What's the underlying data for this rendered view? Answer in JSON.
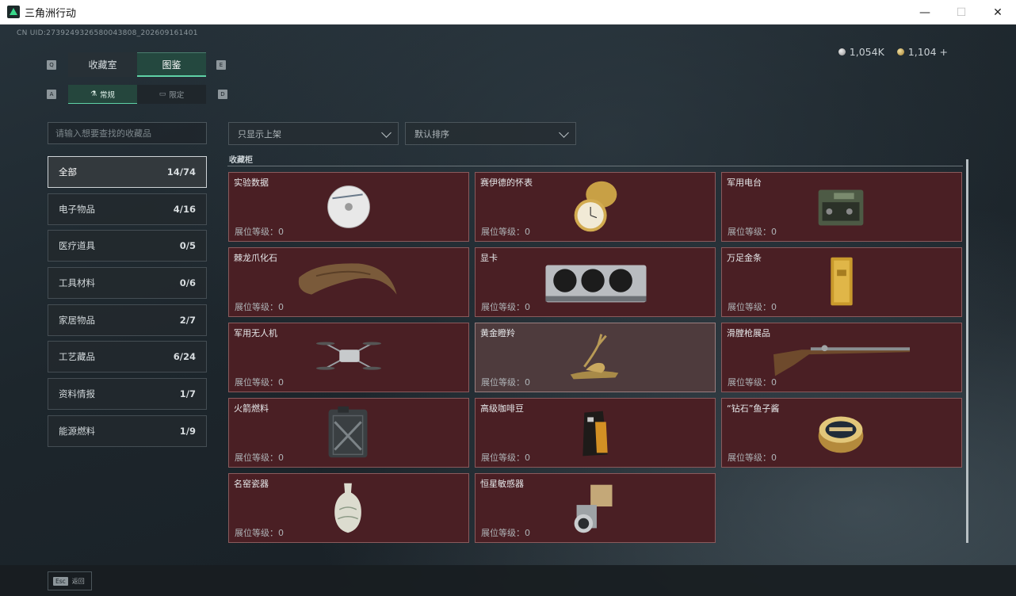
{
  "window": {
    "title": "三角洲行动",
    "minimize": "—",
    "maximize": "☐",
    "close": "✕"
  },
  "header": {
    "uid": "CN UID:2739249326580043808_202609161401",
    "currency": [
      {
        "icon": "silver-coin-icon",
        "value": "1,054K"
      },
      {
        "icon": "gold-coin-icon",
        "value": "1,104 +"
      }
    ]
  },
  "tabs": {
    "key_left": "Q",
    "key_right": "E",
    "main": [
      {
        "label": "收藏室",
        "active": false
      },
      {
        "label": "图鉴",
        "active": true
      }
    ],
    "sub_key_left": "A",
    "sub_key_right": "D",
    "sub": [
      {
        "label": "常规",
        "icon": "flask-icon",
        "active": true
      },
      {
        "label": "限定",
        "icon": "frame-icon",
        "active": false
      }
    ]
  },
  "search": {
    "placeholder": "请输入想要查找的收藏品",
    "value": ""
  },
  "filters": [
    {
      "label": "只显示上架"
    },
    {
      "label": "默认排序"
    }
  ],
  "categories": [
    {
      "label": "全部",
      "count": "14/74",
      "active": true
    },
    {
      "label": "电子物品",
      "count": "4/16"
    },
    {
      "label": "医疗道具",
      "count": "0/5"
    },
    {
      "label": "工具材料",
      "count": "0/6"
    },
    {
      "label": "家居物品",
      "count": "2/7"
    },
    {
      "label": "工艺藏品",
      "count": "6/24"
    },
    {
      "label": "资料情报",
      "count": "1/7"
    },
    {
      "label": "能源燃料",
      "count": "1/9"
    }
  ],
  "section_title": "收藏柜",
  "level_label": "展位等级：0",
  "items": [
    {
      "name": "实验数据",
      "icon": "disc-icon"
    },
    {
      "name": "赛伊德的怀表",
      "icon": "pocket-watch-icon"
    },
    {
      "name": "军用电台",
      "icon": "radio-icon"
    },
    {
      "name": "棘龙爪化石",
      "icon": "claw-fossil-icon"
    },
    {
      "name": "显卡",
      "icon": "graphics-card-icon"
    },
    {
      "name": "万足金条",
      "icon": "gold-bar-icon"
    },
    {
      "name": "军用无人机",
      "icon": "drone-icon"
    },
    {
      "name": "黄金瞪羚",
      "icon": "gazelle-icon",
      "highlight": true
    },
    {
      "name": "滑膛枪展品",
      "icon": "musket-icon"
    },
    {
      "name": "火箭燃料",
      "icon": "fuel-can-icon"
    },
    {
      "name": "高级咖啡豆",
      "icon": "coffee-bag-icon"
    },
    {
      "name": "“钻石”鱼子酱",
      "icon": "caviar-tin-icon"
    },
    {
      "name": "名窑瓷器",
      "icon": "porcelain-vase-icon"
    },
    {
      "name": "恒星敏感器",
      "icon": "star-sensor-icon"
    }
  ],
  "footer": {
    "esc_key": "Esc",
    "esc_label": "返回"
  },
  "colors": {
    "card_bg": "#4a1f24",
    "accent": "#5fd1a6"
  }
}
